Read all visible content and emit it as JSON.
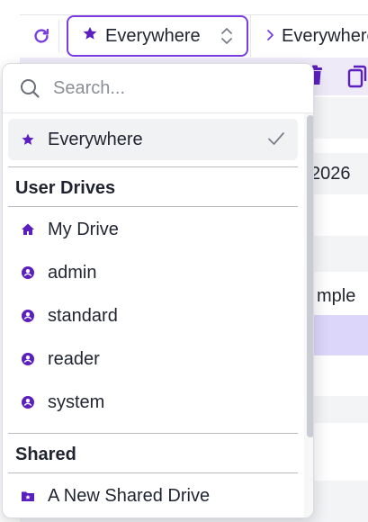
{
  "toolbar": {
    "scope_value": "Everywhere",
    "breadcrumb_text": "Everywhere"
  },
  "background_rows": {
    "row_text_1": "2026",
    "row_text_2": "mple"
  },
  "dropdown": {
    "search": {
      "placeholder": "Search...",
      "value": ""
    },
    "selected_item": {
      "label": "Everywhere",
      "icon": "star-icon"
    },
    "groups": [
      {
        "header": "User Drives",
        "items": [
          {
            "label": "My Drive",
            "icon": "home-icon"
          },
          {
            "label": "admin",
            "icon": "user-circle-icon"
          },
          {
            "label": "standard",
            "icon": "user-circle-icon"
          },
          {
            "label": "reader",
            "icon": "user-circle-icon"
          },
          {
            "label": "system",
            "icon": "user-circle-icon"
          }
        ]
      },
      {
        "header": "Shared",
        "items": [
          {
            "label": "A New Shared Drive",
            "icon": "shared-folder-icon"
          }
        ]
      }
    ]
  },
  "colors": {
    "accent": "#7a3ee0",
    "highlight_row": "#ddd6fb",
    "selected_bg": "#f1f2f4"
  }
}
